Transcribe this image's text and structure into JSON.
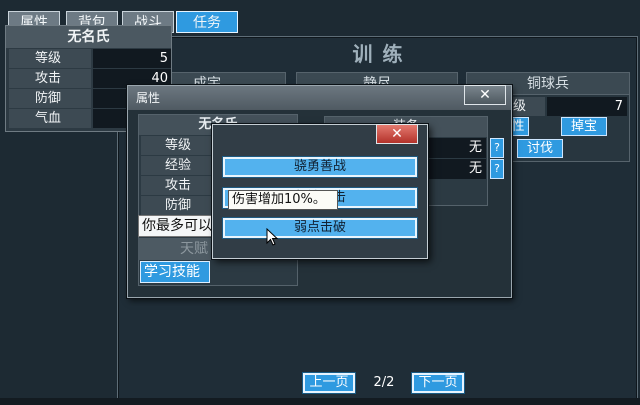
{
  "tabs": [
    {
      "label": "属性",
      "active": false
    },
    {
      "label": "背包",
      "active": false
    },
    {
      "label": "战斗",
      "active": false
    },
    {
      "label": "任务",
      "active": true
    }
  ],
  "training": {
    "title": "训练",
    "enemies": [
      {
        "name": "成宇"
      },
      {
        "name": "静尽"
      },
      {
        "name": "铜球兵",
        "level": "7",
        "btn_left": "性",
        "btn_drop": "掉宝",
        "btn_fight": "讨伐"
      }
    ]
  },
  "mini_stats": {
    "name": "无名氏",
    "rows": [
      {
        "label": "等级",
        "value": "5"
      },
      {
        "label": "攻击",
        "value": "40"
      },
      {
        "label": "防御",
        "value": ""
      },
      {
        "label": "气血",
        "value": ""
      }
    ]
  },
  "attr_window": {
    "title": "属性",
    "name": "无名氏",
    "rows": [
      {
        "label": "等级"
      },
      {
        "label": "经验"
      },
      {
        "label": "攻击"
      },
      {
        "label": "防御"
      }
    ],
    "hint": "你最多可以",
    "talent": "天赋",
    "learn_skill": "学习技能",
    "equip_header": "装备",
    "slot1": "无",
    "slot2": "无",
    "question": "?",
    "mid_label": "级"
  },
  "skill_popup": {
    "skills": [
      "骁勇善战",
      "凝神一击",
      "弱点击破"
    ],
    "tooltip": "伤害增加10%。"
  },
  "pager": {
    "prev": "上一页",
    "indicator": "2/2",
    "next": "下一页"
  },
  "colors": {
    "accent": "#2f9ae0",
    "close_red": "#c53a31",
    "background": "#1d2a33"
  }
}
